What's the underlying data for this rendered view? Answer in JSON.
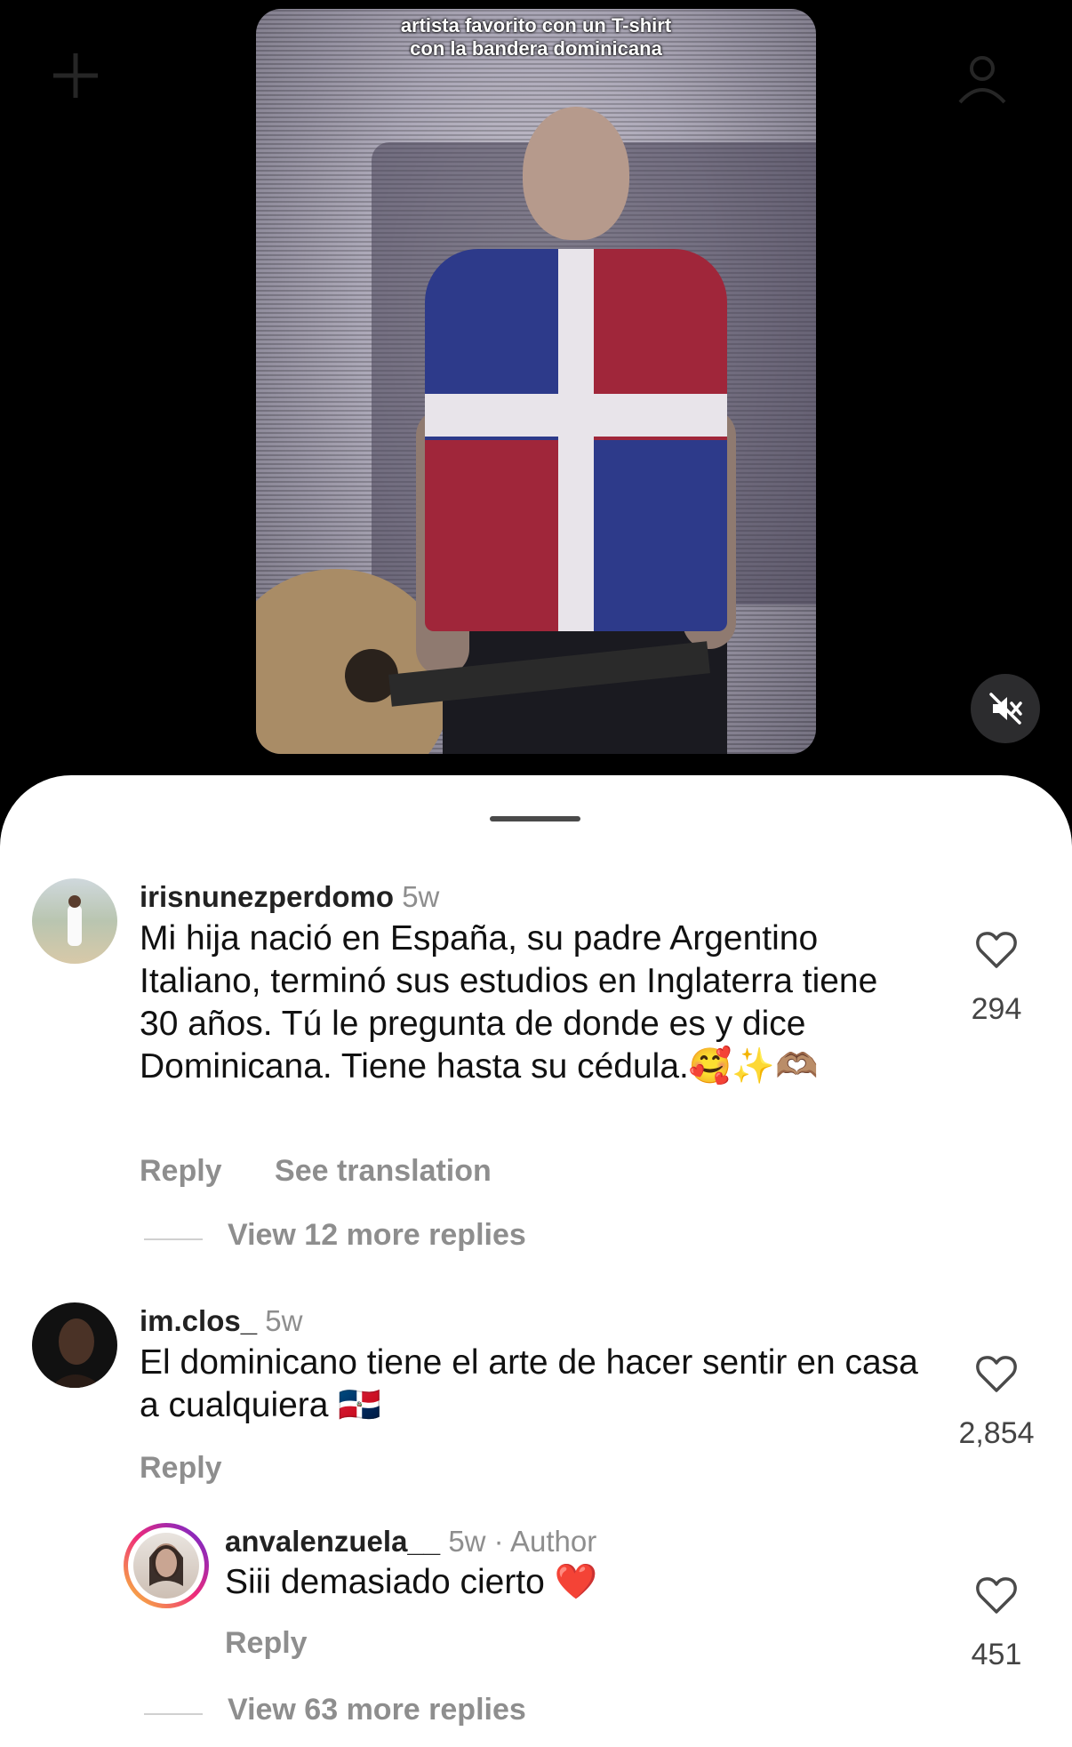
{
  "video": {
    "caption_line1": "artista favorito con un T-shirt",
    "caption_line2": "con la bandera dominicana"
  },
  "icons": {
    "plus": "plus-icon",
    "profile": "profile-icon",
    "mute": "speaker-muted-icon",
    "heart": "heart-outline-icon"
  },
  "comments": [
    {
      "username": "irisnunezperdomo",
      "time": "5w",
      "text": "Mi hija nació en España, su padre Argentino Italiano, terminó sus estudios en Inglaterra tiene 30 años. Tú le pregunta de donde es y dice Dominicana. Tiene hasta su cédula.🥰✨🫶🏽",
      "reply_label": "Reply",
      "translate_label": "See translation",
      "likes": "294",
      "view_replies": "View 12 more replies"
    },
    {
      "username": "im.clos_",
      "time": "5w",
      "text": "El dominicano tiene el arte de hacer sentir en casa a cualquiera 🇩🇴",
      "reply_label": "Reply",
      "likes": "2,854"
    },
    {
      "username": "anvalenzuela__",
      "time": "5w",
      "author_tag": "· Author",
      "text": "Siii demasiado cierto ❤️",
      "reply_label": "Reply",
      "likes": "451",
      "view_replies": "View 63 more replies"
    }
  ],
  "colors": {
    "sheet_bg": "#ffffff",
    "muted_text": "#8e8e8e",
    "story_ring": "#e1306c"
  }
}
